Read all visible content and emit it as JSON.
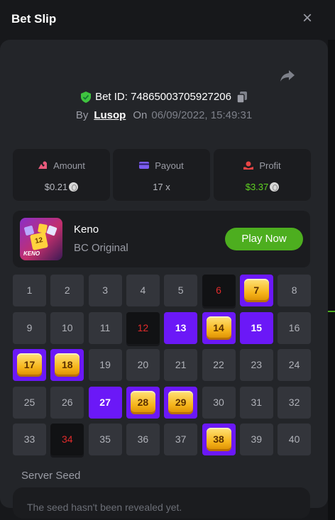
{
  "header": {
    "title": "Bet Slip",
    "close_label": "×"
  },
  "bet": {
    "bet_id_text": "Bet ID: 74865003705927206",
    "by_label": "By",
    "user": "Lusop",
    "on_label": "On",
    "datetime": "06/09/2022, 15:49:31"
  },
  "stats": {
    "amount": {
      "label": "Amount",
      "value": "$0.21",
      "icon": "amount-icon",
      "color": "#e85a7c"
    },
    "payout": {
      "label": "Payout",
      "value": "17 x",
      "icon": "card-icon",
      "color": "#7b5cf0"
    },
    "profit": {
      "label": "Profit",
      "value": "$3.37",
      "icon": "profit-icon",
      "color": "#e84545",
      "value_color": "#5fd321"
    }
  },
  "game": {
    "name": "Keno",
    "subtitle": "BC Original",
    "play_label": "Play Now",
    "thumb_brand": "KENO",
    "thumb_dice_number": "12"
  },
  "keno_grid": {
    "numbers": [
      "1",
      "2",
      "3",
      "4",
      "5",
      "6",
      "7",
      "8",
      "9",
      "10",
      "11",
      "12",
      "13",
      "14",
      "15",
      "16",
      "17",
      "18",
      "19",
      "20",
      "21",
      "22",
      "23",
      "24",
      "25",
      "26",
      "27",
      "28",
      "29",
      "30",
      "31",
      "32",
      "33",
      "34",
      "35",
      "36",
      "37",
      "38",
      "39",
      "40"
    ],
    "states": {
      "6": "miss",
      "7": "hit",
      "12": "miss",
      "13": "sel",
      "14": "hit",
      "15": "sel",
      "17": "hit",
      "18": "hit",
      "27": "sel",
      "28": "hit",
      "29": "hit",
      "34": "miss",
      "38": "hit"
    }
  },
  "seed": {
    "label": "Server Seed",
    "value": "The seed hasn't been revealed yet."
  },
  "colors": {
    "accent_purple": "#6b18f7",
    "play_green": "#4dae1f",
    "miss_red": "#e02b2b"
  }
}
